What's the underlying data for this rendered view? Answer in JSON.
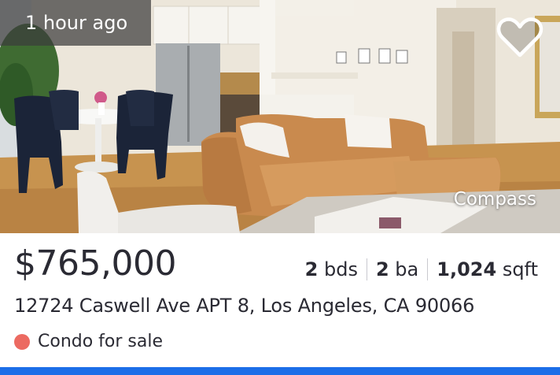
{
  "listing": {
    "time_ago": "1 hour ago",
    "brokerage": "Compass",
    "price": "$765,000",
    "beds_value": "2",
    "beds_unit": "bds",
    "baths_value": "2",
    "baths_unit": "ba",
    "sqft_value": "1,024",
    "sqft_unit": "sqft",
    "address": "12724 Caswell Ave APT 8, Los Angeles, CA 90066",
    "status": "Condo for sale",
    "favorite_icon": "heart-outline-icon"
  },
  "colors": {
    "status_dot": "#ec6a61",
    "accent_bar": "#1c6ee8",
    "text": "#2a2a33"
  }
}
